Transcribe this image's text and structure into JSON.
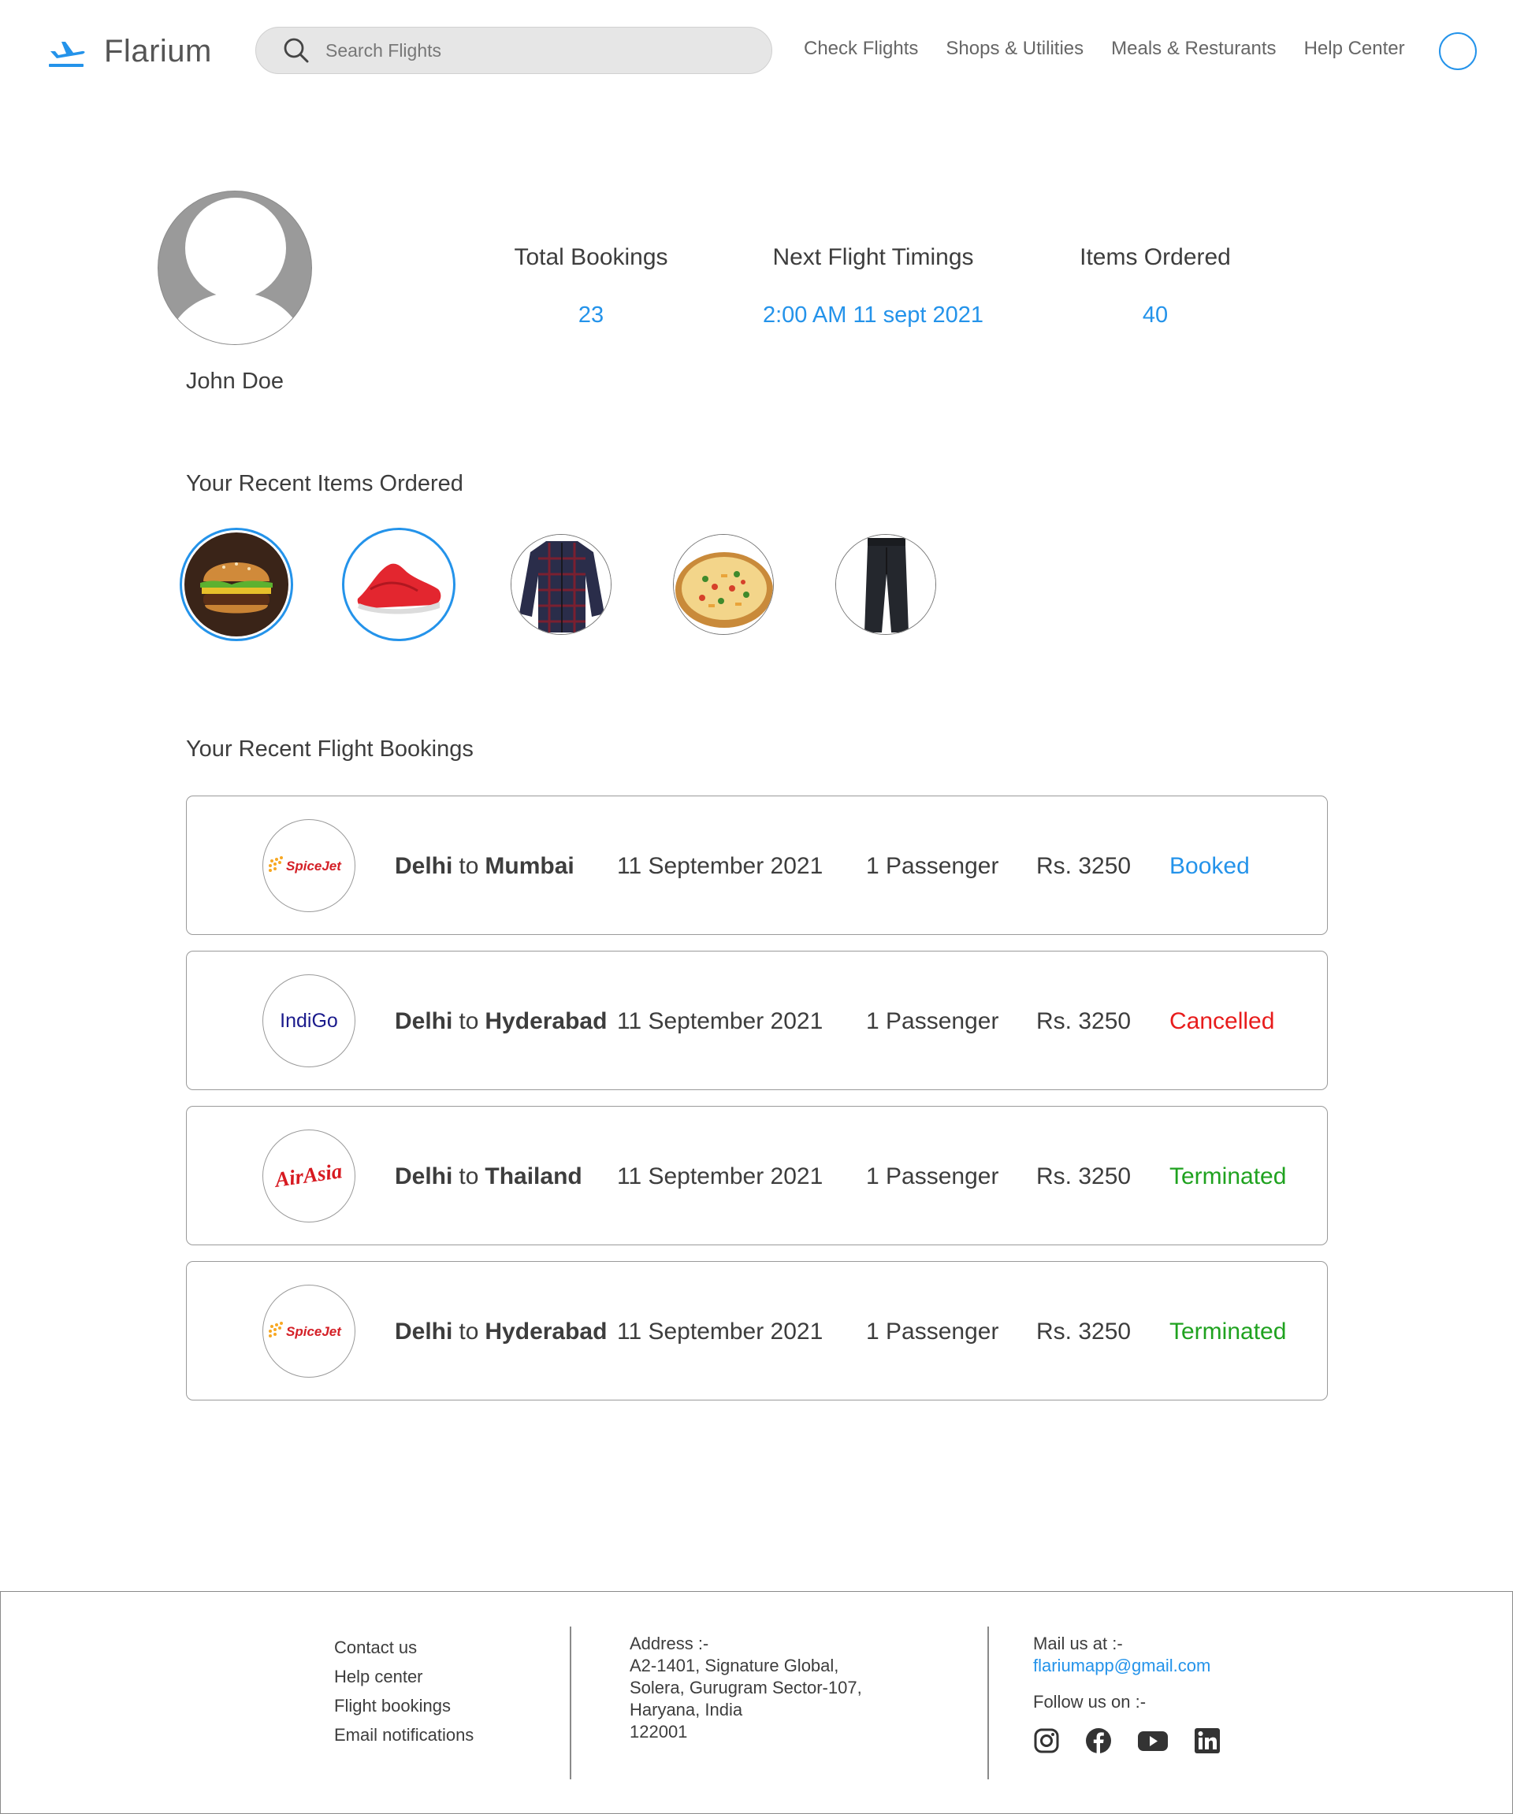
{
  "header": {
    "brand": "Flarium",
    "search_placeholder": "Search Flights",
    "nav": [
      "Check Flights",
      "Shops & Utilities",
      "Meals & Resturants",
      "Help Center"
    ]
  },
  "profile": {
    "name": "John Doe",
    "stats": [
      {
        "label": "Total Bookings",
        "value": "23"
      },
      {
        "label": "Next Flight Timings",
        "value": "2:00 AM 11 sept 2021"
      },
      {
        "label": "Items Ordered",
        "value": "40"
      }
    ]
  },
  "recent_items": {
    "title": "Your Recent Items Ordered",
    "items": [
      {
        "icon": "burger-icon",
        "selected": true
      },
      {
        "icon": "sneaker-icon",
        "selected": true
      },
      {
        "icon": "shirt-icon",
        "selected": false
      },
      {
        "icon": "pizza-icon",
        "selected": false
      },
      {
        "icon": "trousers-icon",
        "selected": false
      }
    ]
  },
  "bookings": {
    "title": "Your Recent Flight Bookings",
    "connector": "to",
    "rows": [
      {
        "airline": "SpiceJet",
        "from": "Delhi",
        "to": "Mumbai",
        "date": "11 September 2021",
        "passengers": "1 Passenger",
        "price": "Rs. 3250",
        "status": "Booked"
      },
      {
        "airline": "IndiGo",
        "from": "Delhi",
        "to": "Hyderabad",
        "date": "11 September 2021",
        "passengers": "1 Passenger",
        "price": "Rs. 3250",
        "status": "Cancelled"
      },
      {
        "airline": "AirAsia",
        "from": "Delhi",
        "to": "Thailand",
        "date": "11 September 2021",
        "passengers": "1 Passenger",
        "price": "Rs. 3250",
        "status": "Terminated"
      },
      {
        "airline": "SpiceJet",
        "from": "Delhi",
        "to": "Hyderabad",
        "date": "11 September 2021",
        "passengers": "1 Passenger",
        "price": "Rs. 3250",
        "status": "Terminated"
      }
    ]
  },
  "footer": {
    "links": [
      "Contact us",
      "Help center",
      "Flight bookings",
      "Email notifications"
    ],
    "address_label": "Address :-",
    "address_lines": [
      "A2-1401, Signature Global,",
      "Solera, Gurugram Sector-107,",
      "Haryana, India",
      "122001"
    ],
    "mail_label": "Mail us at :-",
    "mail": "flariumapp@gmail.com",
    "follow_label": "Follow us on :-",
    "socials": [
      "instagram-icon",
      "facebook-icon",
      "youtube-icon",
      "linkedin-icon"
    ]
  },
  "colors": {
    "accent": "#2493ea",
    "cancelled": "#e81c1c",
    "terminated": "#1fa21f",
    "spicejet": "#d42027",
    "indigo": "#1a1a8c",
    "airasia": "#d71920"
  }
}
